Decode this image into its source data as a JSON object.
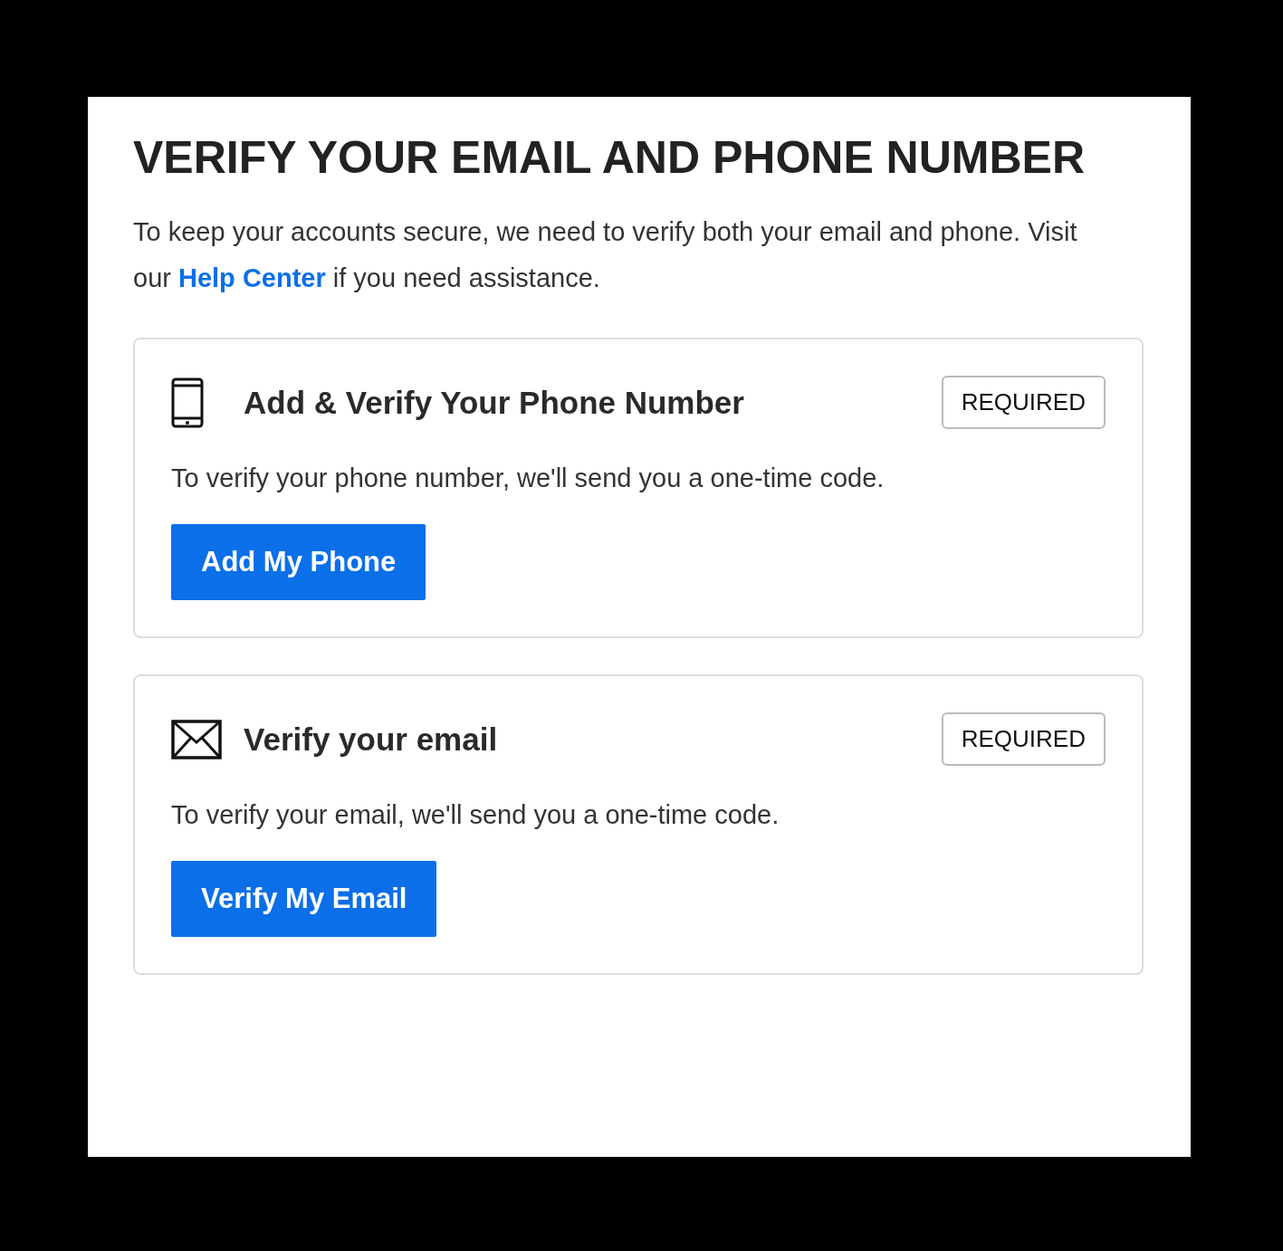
{
  "heading": "VERIFY YOUR EMAIL AND PHONE NUMBER",
  "intro": {
    "before": "To keep your accounts secure, we need to verify both your email and phone. Visit our ",
    "link": "Help Center",
    "after": " if you need assistance."
  },
  "cards": [
    {
      "kind": "phone",
      "title": "Add & Verify Your Phone Number",
      "badge": "REQUIRED",
      "text": "To verify your phone number, we'll send you a one-time code.",
      "button": "Add My Phone"
    },
    {
      "kind": "email",
      "title": "Verify your email",
      "badge": "REQUIRED",
      "text": "To verify your email, we'll send you a one-time code.",
      "button": "Verify My Email"
    }
  ]
}
